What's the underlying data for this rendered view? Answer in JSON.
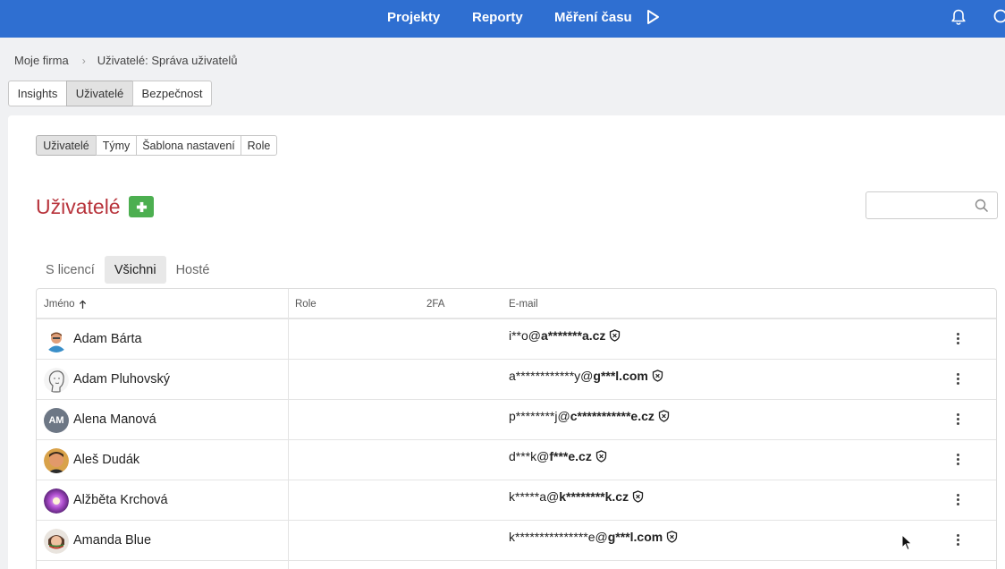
{
  "nav": {
    "items": [
      "Projekty",
      "Reporty",
      "Měření času"
    ]
  },
  "breadcrumb": {
    "root": "Moje firma",
    "current": "Uživatelé: Správa uživatelů"
  },
  "top_tabs": [
    "Insights",
    "Uživatelé",
    "Bezpečnost"
  ],
  "top_tabs_active": "Uživatelé",
  "sub_tabs": [
    "Uživatelé",
    "Týmy",
    "Šablona nastavení",
    "Role"
  ],
  "sub_tabs_active": "Uživatelé",
  "page": {
    "title": "Uživatelé",
    "add_icon": "plus-icon",
    "search_placeholder": ""
  },
  "filter_tabs": [
    "S licencí",
    "Všichni",
    "Hosté"
  ],
  "filter_tabs_active": "Všichni",
  "table": {
    "columns": {
      "name": "Jméno",
      "name_sort_icon": "arrow-up-icon",
      "role": "Role",
      "twofa": "2FA",
      "email": "E-mail"
    },
    "rows": [
      {
        "name": "Adam Bárta",
        "email_local": "i**o@",
        "email_domain": "a*******a.cz",
        "avatar": "photo"
      },
      {
        "name": "Adam Pluhovský",
        "email_local": "a************y@",
        "email_domain": "g***l.com",
        "avatar": "sketch"
      },
      {
        "name": "Alena Manová",
        "email_local": "p********j@",
        "email_domain": "c***********e.cz",
        "avatar": "initials",
        "initials": "AM"
      },
      {
        "name": "Aleš Dudák",
        "email_local": "d***k@",
        "email_domain": "f***e.cz",
        "avatar": "photo"
      },
      {
        "name": "Alžběta Krchová",
        "email_local": "k*****a@",
        "email_domain": "k********k.cz",
        "avatar": "photo"
      },
      {
        "name": "Amanda Blue",
        "email_local": "k***************e@",
        "email_domain": "g***l.com",
        "avatar": "photo"
      }
    ]
  },
  "colors": {
    "nav_bg": "#2f6fd1",
    "title_red": "#b8343c",
    "add_green": "#4caf50"
  }
}
